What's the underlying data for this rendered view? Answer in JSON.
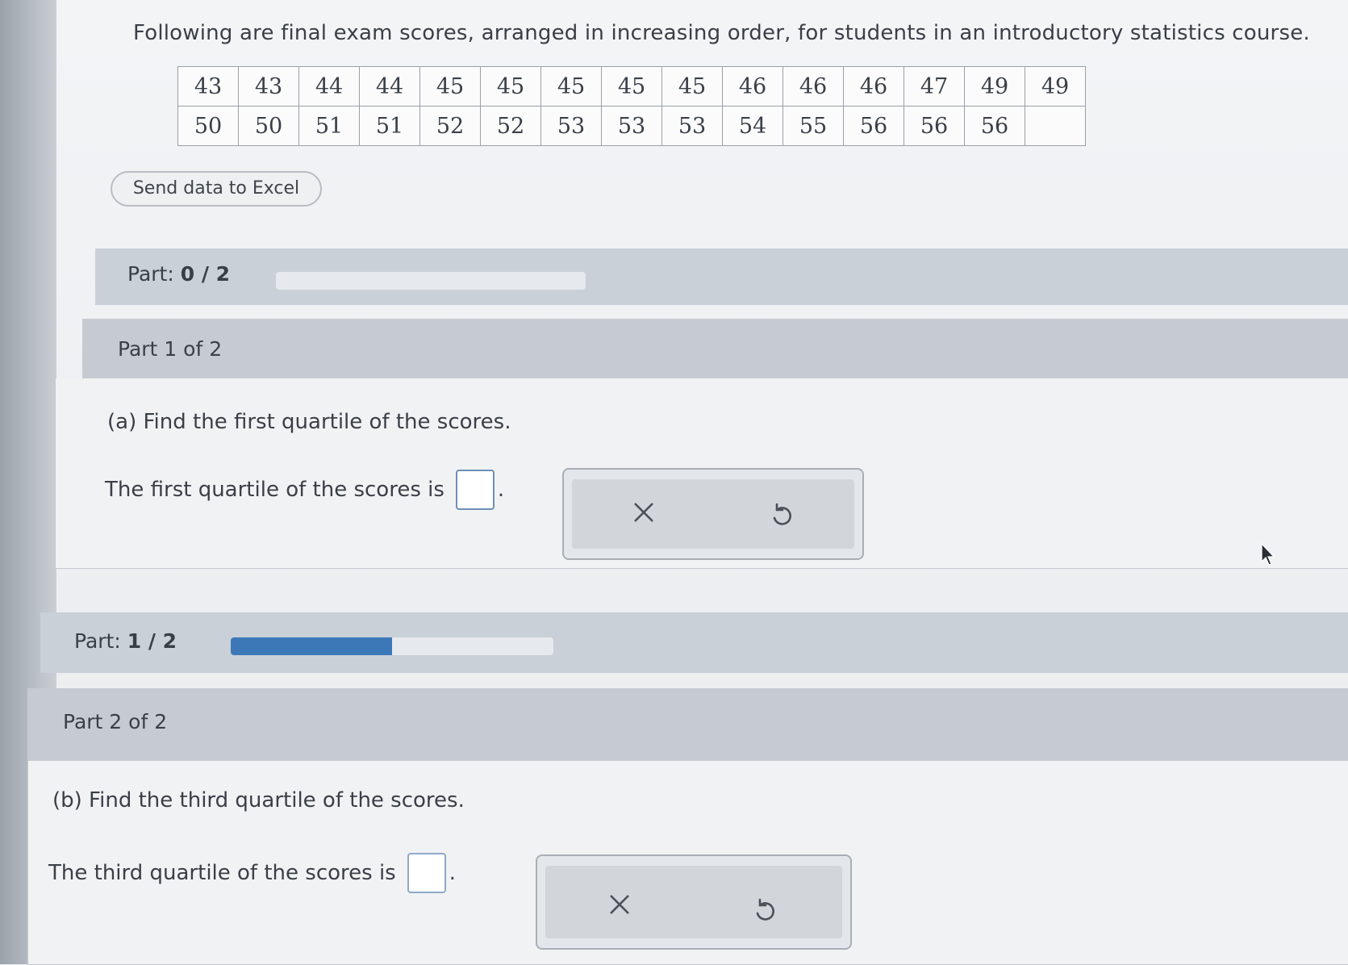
{
  "intro": "Following are final exam scores, arranged in increasing order, for students in an introductory statistics course.",
  "scores": [
    [
      "43",
      "43",
      "44",
      "44",
      "45",
      "45",
      "45",
      "45",
      "45",
      "46",
      "46",
      "46",
      "47",
      "49",
      "49"
    ],
    [
      "50",
      "50",
      "51",
      "51",
      "52",
      "52",
      "53",
      "53",
      "53",
      "54",
      "55",
      "56",
      "56",
      "56",
      ""
    ]
  ],
  "excel_button": "Send data to Excel",
  "progress1": {
    "label": "Part:",
    "value": "0 / 2",
    "fraction": 0
  },
  "part1": {
    "header": "Part 1 of 2",
    "question": "(a) Find the first quartile of the scores.",
    "answer_prefix": "The first quartile of the scores is",
    "answer_suffix": "."
  },
  "progress2": {
    "label": "Part:",
    "value": "1 / 2",
    "fraction": 0.5
  },
  "part2": {
    "header": "Part 2 of 2",
    "question": "(b) Find the third quartile of the scores.",
    "answer_prefix": "The third quartile of the scores is",
    "answer_suffix": "."
  },
  "icons": {
    "clear": "close-icon",
    "undo": "undo-icon"
  },
  "colors": {
    "progress_fill": "#3c78b8",
    "input_border": "#6d8fb5"
  }
}
